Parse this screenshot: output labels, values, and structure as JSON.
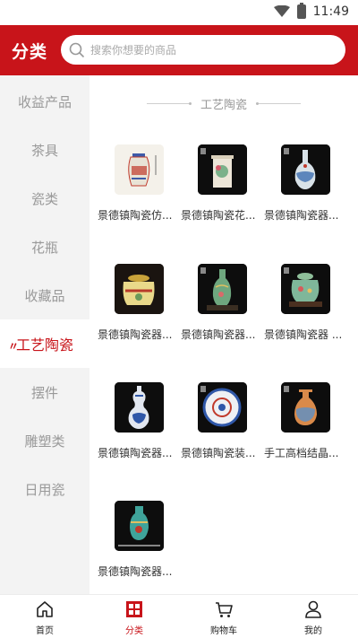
{
  "status": {
    "time": "11:49"
  },
  "header": {
    "title": "分类",
    "search_placeholder": "搜索你想要的商品"
  },
  "sidebar": {
    "items": [
      {
        "label": "收益产品"
      },
      {
        "label": "茶具"
      },
      {
        "label": "瓷类"
      },
      {
        "label": "花瓶"
      },
      {
        "label": "收藏品"
      },
      {
        "label": "工艺陶瓷",
        "active": true
      },
      {
        "label": "摆件"
      },
      {
        "label": "雕塑类"
      },
      {
        "label": "日用瓷"
      }
    ]
  },
  "section": {
    "title": "工艺陶瓷"
  },
  "products": [
    {
      "name": "景德镇陶瓷仿..."
    },
    {
      "name": "景德镇陶瓷花..."
    },
    {
      "name": "景德镇陶瓷器..."
    },
    {
      "name": "景德镇陶瓷器..."
    },
    {
      "name": "景德镇陶瓷器..."
    },
    {
      "name": "景德镇陶瓷器 ..."
    },
    {
      "name": "景德镇陶瓷器..."
    },
    {
      "name": "景德镇陶瓷装..."
    },
    {
      "name": "手工高档结晶..."
    },
    {
      "name": "景德镇陶瓷器..."
    }
  ],
  "tabbar": {
    "tabs": [
      {
        "label": "首页",
        "icon": "home-icon"
      },
      {
        "label": "分类",
        "icon": "category-icon",
        "active": true
      },
      {
        "label": "购物车",
        "icon": "cart-icon"
      },
      {
        "label": "我的",
        "icon": "user-icon"
      }
    ]
  },
  "colors": {
    "brand": "#c8141a",
    "sidebar_bg": "#f3f3f3",
    "muted_text": "#999999"
  }
}
